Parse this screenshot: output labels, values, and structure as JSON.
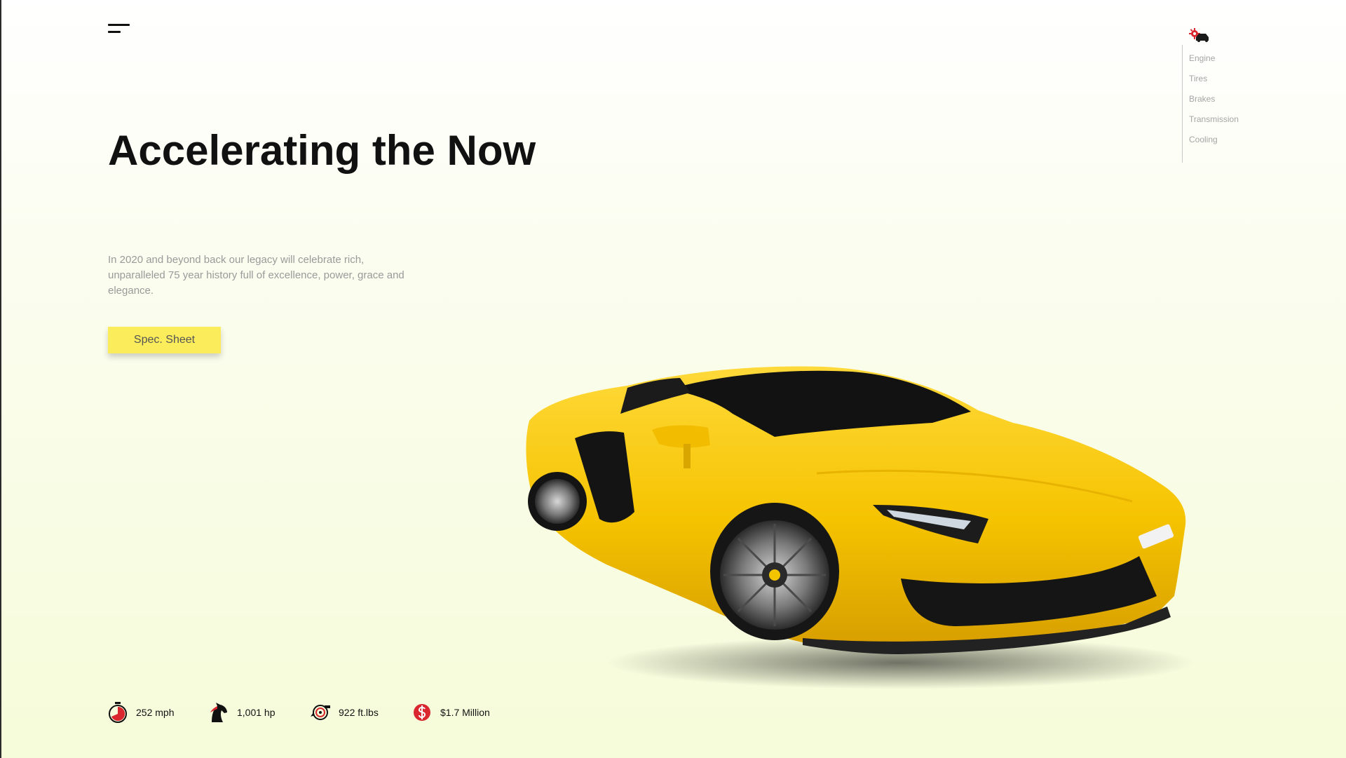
{
  "hero": {
    "title": "Accelerating the Now",
    "description": "In 2020 and beyond back our legacy will celebrate rich, unparalleled 75 year history full of excellence, power, grace and elegance.",
    "cta_label": "Spec. Sheet"
  },
  "side_nav": {
    "brand_icon": "gear-car-icon",
    "items": [
      {
        "label": "Engine"
      },
      {
        "label": "Tires"
      },
      {
        "label": "Brakes"
      },
      {
        "label": "Transmission"
      },
      {
        "label": "Cooling"
      }
    ]
  },
  "stats": [
    {
      "icon": "stopwatch-icon",
      "text": "252 mph"
    },
    {
      "icon": "horse-icon",
      "text": "1,001 hp"
    },
    {
      "icon": "turbo-icon",
      "text": "922 ft.lbs"
    },
    {
      "icon": "dollar-icon",
      "text": "$1.7 Million"
    }
  ],
  "colors": {
    "accent": "#fbec5c",
    "car_body": "#f6c600",
    "icon_red": "#d9262f",
    "text_muted": "#9a9a9a"
  }
}
